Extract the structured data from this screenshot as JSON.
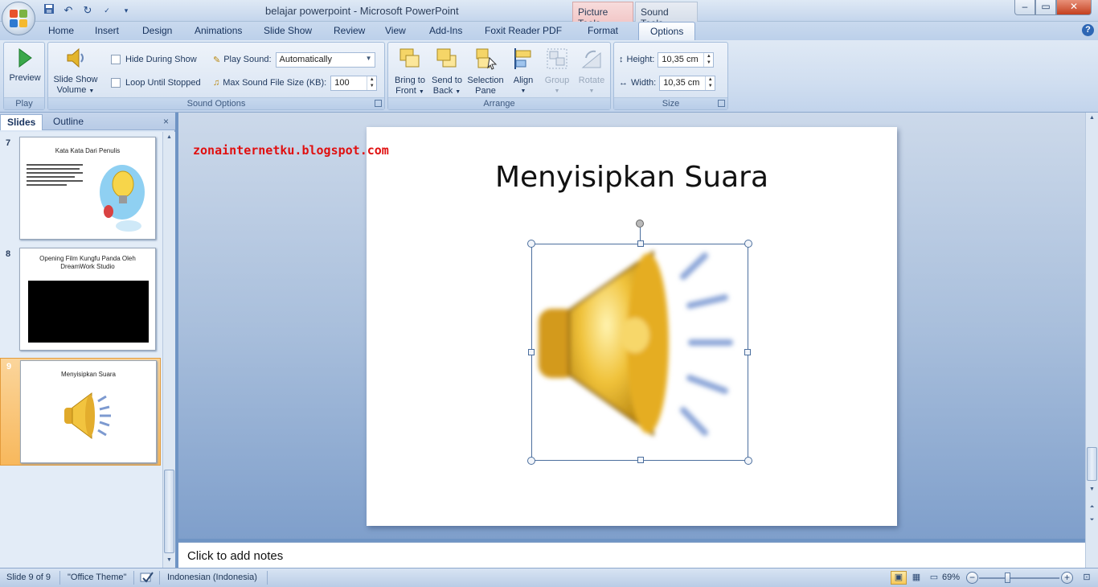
{
  "window": {
    "title": "belajar powerpoint - Microsoft PowerPoint",
    "context_tabs": [
      "Picture Tools",
      "Sound Tools"
    ],
    "controls": {
      "minimize": "–",
      "maximize": "▭",
      "close": "✕"
    }
  },
  "quick_access": {
    "save_icon": "save-icon",
    "undo_icon": "undo-icon",
    "redo_icon": "redo-icon",
    "spell_icon": "spelling-icon",
    "customize_icon": "customize-icon"
  },
  "tabs": [
    "Home",
    "Insert",
    "Design",
    "Animations",
    "Slide Show",
    "Review",
    "View",
    "Add-Ins",
    "Foxit Reader PDF",
    "Format",
    "Options"
  ],
  "active_tab": "Options",
  "ribbon": {
    "play_group": {
      "label": "Play",
      "preview": "Preview"
    },
    "sound_options": {
      "label": "Sound Options",
      "volume_line1": "Slide Show",
      "volume_line2": "Volume",
      "hide_during_show": "Hide During Show",
      "loop_until_stopped": "Loop Until Stopped",
      "play_sound_label": "Play Sound:",
      "play_sound_value": "Automatically",
      "max_size_label": "Max Sound File Size (KB):",
      "max_size_value": "100"
    },
    "arrange": {
      "label": "Arrange",
      "bring_front_1": "Bring to",
      "bring_front_2": "Front",
      "send_back_1": "Send to",
      "send_back_2": "Back",
      "selection_1": "Selection",
      "selection_2": "Pane",
      "align": "Align",
      "group": "Group",
      "rotate": "Rotate"
    },
    "size": {
      "label": "Size",
      "height_label": "Height:",
      "height_value": "10,35 cm",
      "width_label": "Width:",
      "width_value": "10,35 cm"
    }
  },
  "left_pane": {
    "tabs": [
      "Slides",
      "Outline"
    ],
    "close": "×",
    "slides": [
      {
        "number": "7",
        "title": "Kata Kata Dari Penulis"
      },
      {
        "number": "8",
        "title": "Opening Film Kungfu Panda Oleh DreamWork Studio"
      },
      {
        "number": "9",
        "title": "Menyisipkan Suara"
      }
    ]
  },
  "editor": {
    "watermark": "zonainternetku.blogspot.com",
    "slide_title": "Menyisipkan Suara"
  },
  "notes": {
    "placeholder": "Click to add notes"
  },
  "status_bar": {
    "slide_info": "Slide 9 of 9",
    "theme": "\"Office Theme\"",
    "language": "Indonesian (Indonesia)",
    "zoom": "69%"
  },
  "colors": {
    "accent": "#2d66b4",
    "selected_slide": "#f8b85c",
    "watermark": "#e01010"
  }
}
